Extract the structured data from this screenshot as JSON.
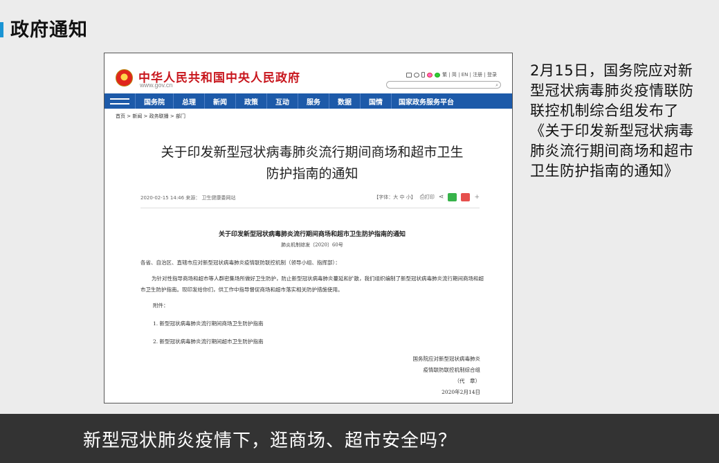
{
  "slide": {
    "title": "政府通知",
    "side_text": "2月15日，国务院应对新型冠状病毒肺炎疫情联防联控机制综合组发布了《关于印发新型冠状病毒肺炎流行期间商场和超市卫生防护指南的通知》",
    "bottom_caption": "新型冠状肺炎疫情下，逛商场、超市安全吗？",
    "colors": {
      "accent": "#1a94d4",
      "bottom_bar": "#333333",
      "gov_red": "#c8161d",
      "gov_nav_blue": "#1d5aa9"
    }
  },
  "screenshot": {
    "site_name": "中华人民共和国中央人民政府",
    "site_url": "www.gov.cn",
    "top_links": "繁 | 简 | EN | 注册 | 登录",
    "nav": [
      "国务院",
      "总理",
      "新闻",
      "政策",
      "互动",
      "服务",
      "数据",
      "国情",
      "国家政务服务平台"
    ],
    "breadcrumb": "首页 > 新闻 > 政务联播 > 部门",
    "article_title_line1": "关于印发新型冠状病毒肺炎流行期间商场和超市卫生",
    "article_title_line2": "防护指南的通知",
    "meta_left": "2020-02-15 14:46   来源： 卫生健康委网站",
    "font_size_label": "【字体：大 中 小】",
    "print_label": "打印",
    "doc_heading": "关于印发新型冠状病毒肺炎流行期间商场和超市卫生防护指南的通知",
    "doc_number": "肺炎机制综发〔2020〕60号",
    "address": "各省、自治区、直辖市应对新型冠状病毒肺炎疫情联防联控机制（领导小组、指挥部）：",
    "body": "为针对性指导商场和超市等人群密集场所做好卫生防护，防止新型冠状病毒肺炎蔓延和扩散，我们组织编制了新型冠状病毒肺炎流行期间商场和超市卫生防护指南。现印发给你们，供工作中指导督促商场和超市落实相关防护措施使用。",
    "attachment_label": "附件：",
    "attachment_1": "1. 新型冠状病毒肺炎流行期间商场卫生防护指南",
    "attachment_2": "2. 新型冠状病毒肺炎流行期间超市卫生防护指南",
    "sign_line1": "国务院应对新型冠状病毒肺炎",
    "sign_line2": "疫情联防联控机制综合组",
    "sign_line3": "（代　章）",
    "sign_date": "2020年2月14日",
    "icons": [
      "mail-icon",
      "clock-icon",
      "mobile-icon",
      "weibo-icon",
      "wechat-icon",
      "search-icon",
      "print-icon",
      "share-icon",
      "plus-icon"
    ]
  }
}
